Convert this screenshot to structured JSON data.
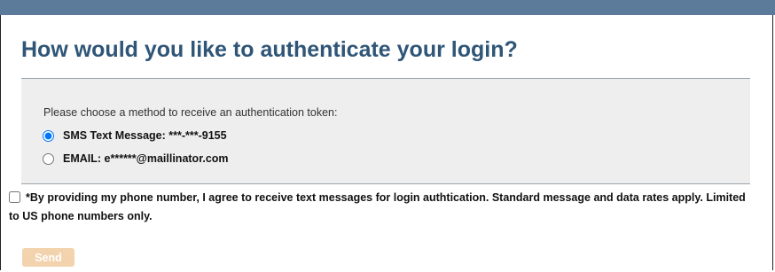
{
  "page": {
    "title": "How would you like to authenticate your login?"
  },
  "auth_method": {
    "instruction": "Please choose a method to receive an authentication token:",
    "options": [
      {
        "label": "SMS Text Message: ***-***-9155",
        "selected": true
      },
      {
        "label": "EMAIL: e******@maillinator.com",
        "selected": false
      }
    ]
  },
  "consent": {
    "checked": false,
    "text": "*By providing my phone number, I agree to receive text messages for login authtication. Standard message and data rates apply. Limited to US phone numbers only."
  },
  "actions": {
    "send_label": "Send",
    "send_enabled": false
  },
  "colors": {
    "top_bar": "#5c7a99",
    "title": "#2f5577",
    "panel_bg": "#eeeeee",
    "send_button_disabled": "#f2d3ad"
  }
}
